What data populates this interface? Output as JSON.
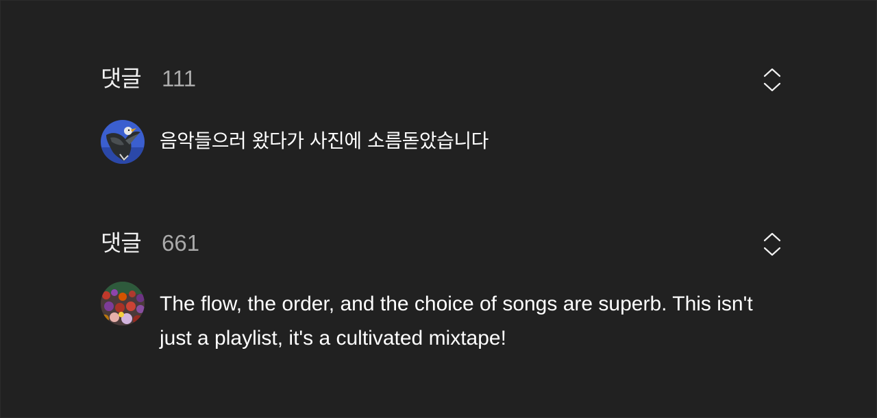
{
  "comment_sections": [
    {
      "header": {
        "title": "댓글",
        "count": "111"
      },
      "comment": {
        "text": "음악들으러 왔다가 사진에 소름돋았습니다"
      }
    },
    {
      "header": {
        "title": "댓글",
        "count": "661"
      },
      "comment": {
        "text": "The flow, the order, and the choice of songs are superb. This isn't just a playlist, it's a cultivated mixtape!"
      }
    }
  ],
  "icons": {
    "expand": "unfold-more-icon",
    "avatar_1": "eagle-avatar",
    "avatar_2": "crowd-avatar"
  },
  "colors": {
    "background": "#212121",
    "primary_text": "#f1f1f1",
    "secondary_text": "#aaaaaa"
  }
}
